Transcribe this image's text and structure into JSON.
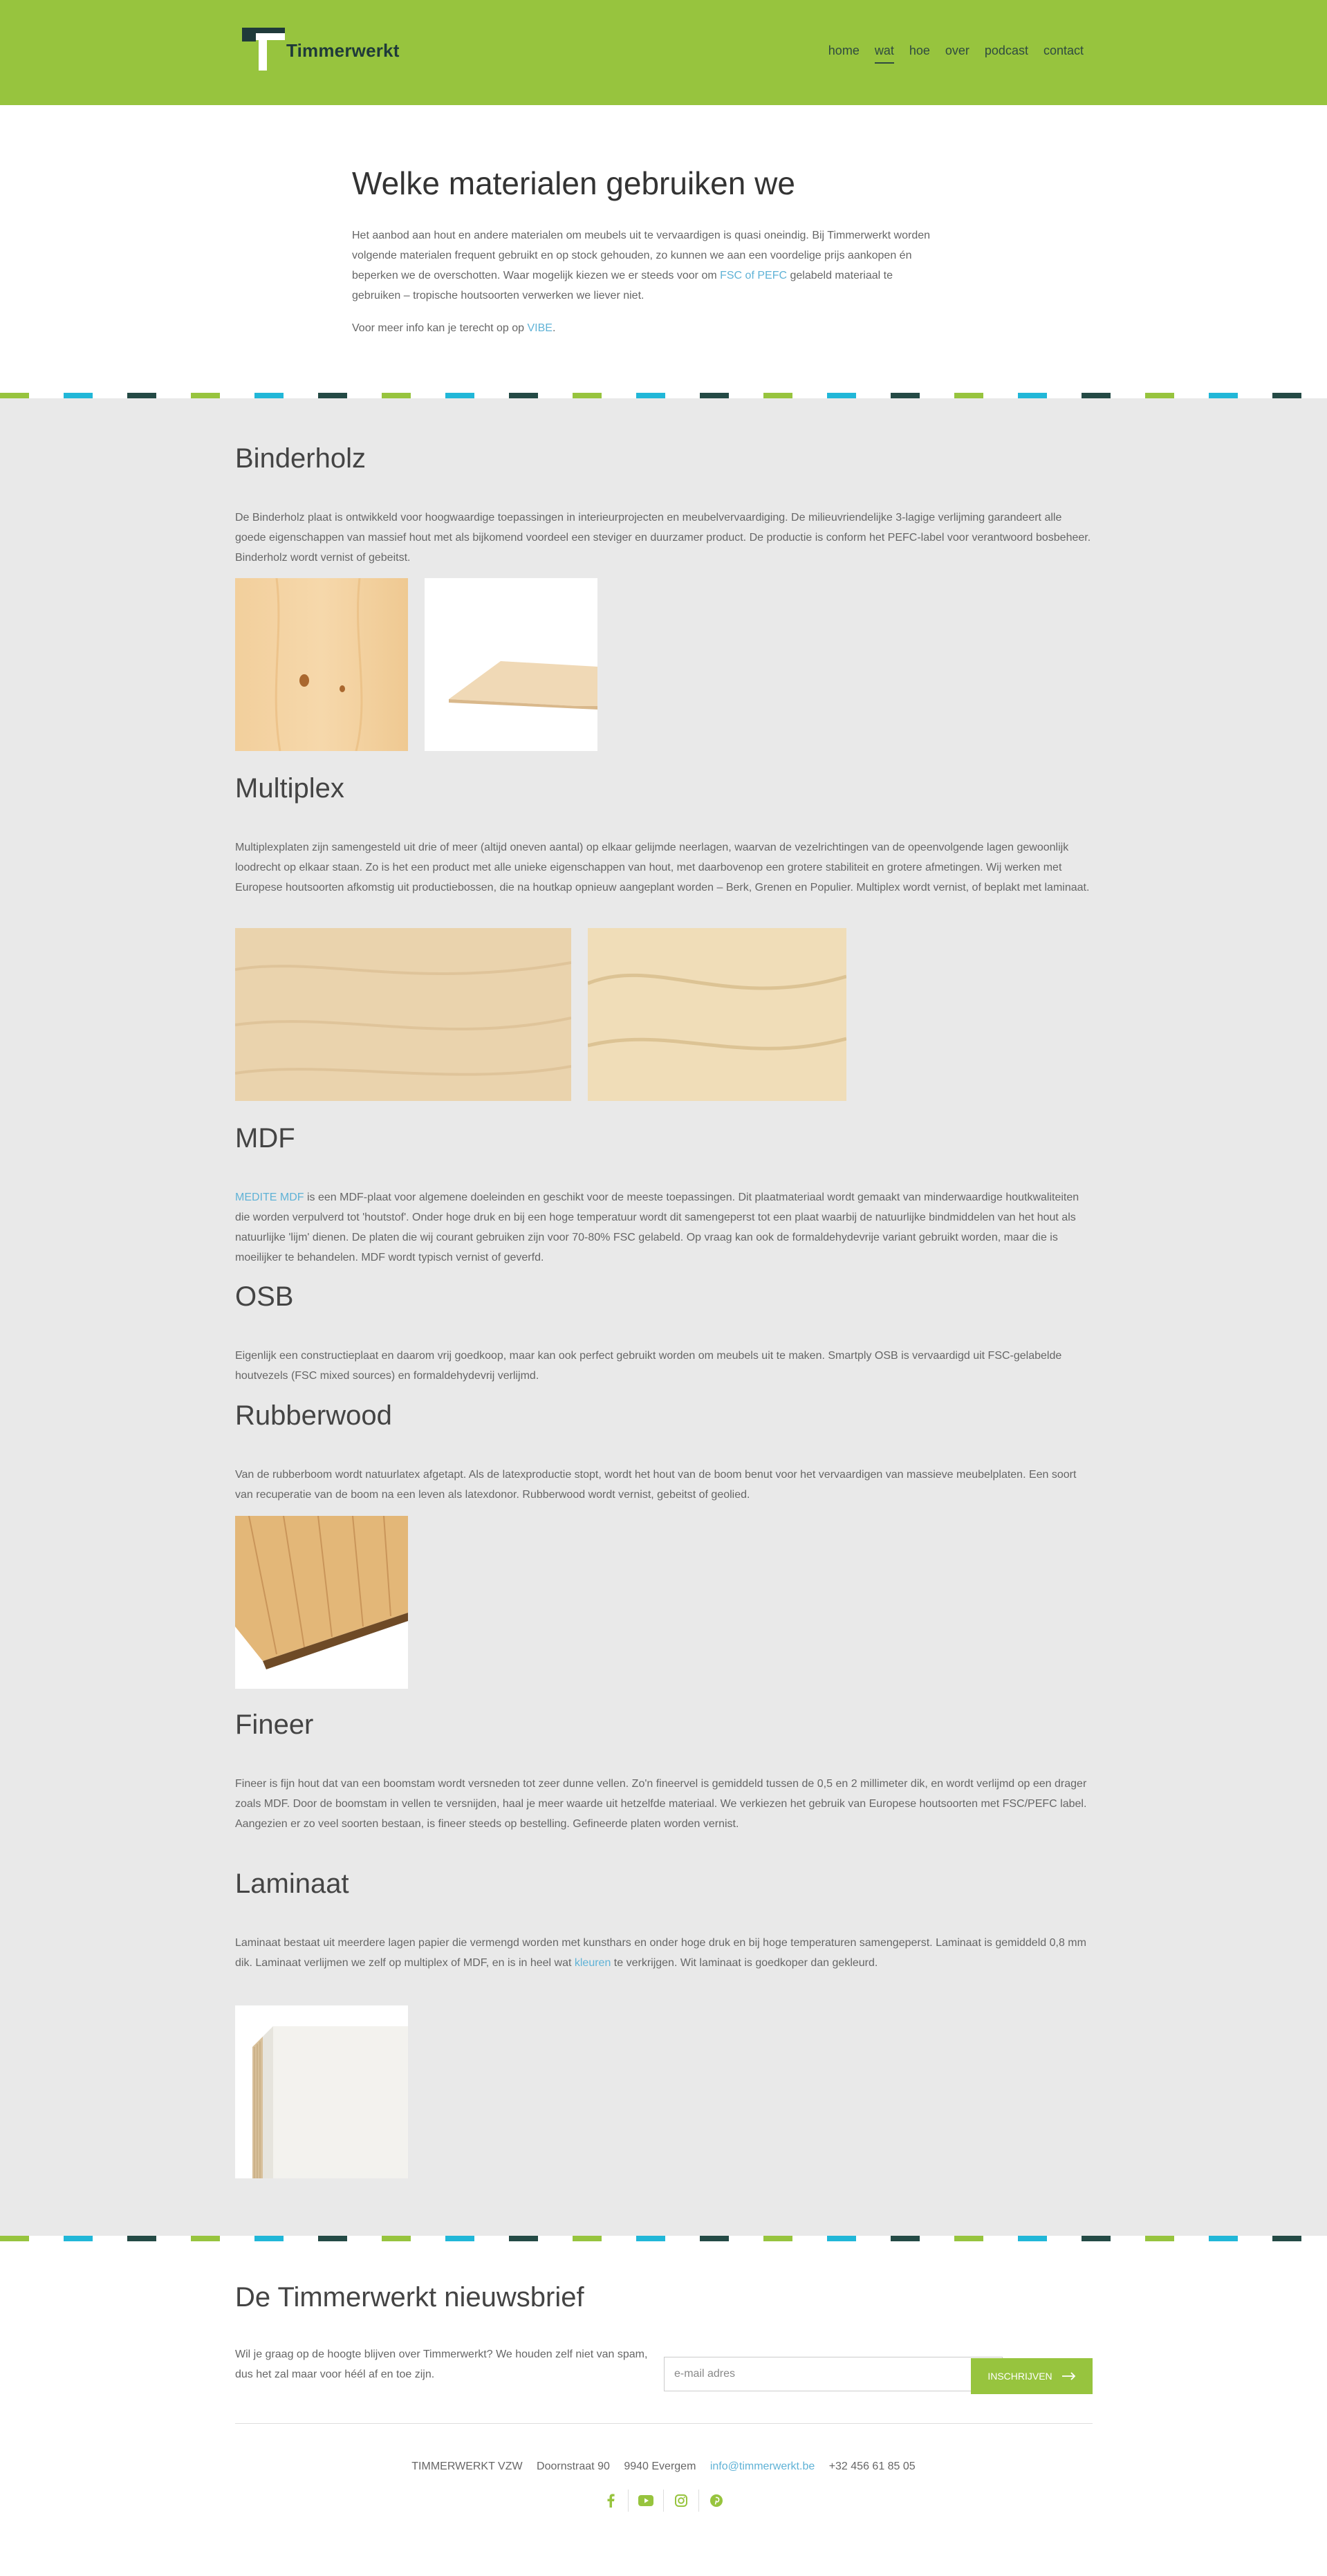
{
  "header": {
    "brand": "Timmerwerkt",
    "nav": [
      {
        "label": "home"
      },
      {
        "label": "wat"
      },
      {
        "label": "hoe"
      },
      {
        "label": "over"
      },
      {
        "label": "podcast"
      },
      {
        "label": "contact"
      }
    ]
  },
  "intro": {
    "title": "Welke materialen gebruiken we",
    "p1_a": "Het aanbod aan hout en andere materialen om meubels uit te vervaardigen is quasi oneindig. Bij Timmerwerkt worden volgende materialen frequent gebruikt en op stock gehouden, zo kunnen we aan een voordelige prijs aankopen én beperken we de overschotten. Waar mogelijk kiezen we er steeds voor om ",
    "p1_link": "FSC of PEFC",
    "p1_b": " gelabeld materiaal te gebruiken – tropische houtsoorten verwerken we liever niet.",
    "p2_a": "Voor meer info kan je terecht op op ",
    "p2_link": "VIBE",
    "p2_b": "."
  },
  "materials": {
    "binderholz": {
      "title": "Binderholz",
      "text": "De Binderholz plaat is ontwikkeld voor hoogwaardige toepassingen in interieurprojecten en meubelvervaardiging. De milieuvriendelijke 3-lagige verlijming garandeert alle goede eigenschappen van massief hout met als bijkomend voordeel een steviger en duurzamer product. De productie is conform het PEFC-label voor verantwoord bosbeheer. Binderholz wordt vernist of gebeitst."
    },
    "multiplex": {
      "title": "Multiplex",
      "text": "Multiplexplaten zijn samengesteld uit drie of meer (altijd oneven aantal) op elkaar gelijmde neerlagen, waarvan de vezelrichtingen van de opeenvolgende lagen gewoonlijk loodrecht op elkaar staan. Zo is het een product met alle unieke eigenschappen van hout, met daarbovenop een grotere stabiliteit en grotere afmetingen. Wij werken met Europese houtsoorten afkomstig uit productiebossen, die na houtkap opnieuw aangeplant worden – Berk, Grenen en Populier. Multiplex wordt vernist, of beplakt met laminaat."
    },
    "mdf": {
      "title": "MDF",
      "link": "MEDITE MDF",
      "text": " is een MDF-plaat voor algemene doeleinden en geschikt voor de meeste toepassingen. Dit plaatmateriaal wordt gemaakt van minderwaardige houtkwaliteiten die worden verpulverd tot 'houtstof'. Onder hoge druk en bij een hoge temperatuur wordt dit samengeperst tot een plaat waarbij de natuurlijke bindmiddelen van het hout als natuurlijke 'lijm' dienen. De platen die wij courant gebruiken zijn voor 70-80% FSC gelabeld. Op vraag kan ook de formaldehydevrije variant gebruikt worden, maar die is moeilijker te behandelen. MDF wordt typisch vernist of geverfd."
    },
    "osb": {
      "title": "OSB",
      "text": "Eigenlijk een constructieplaat en daarom vrij goedkoop, maar kan ook perfect gebruikt worden om meubels uit te maken. Smartply OSB is vervaardigd uit FSC-gelabelde houtvezels (FSC mixed sources) en formaldehydevrij verlijmd."
    },
    "rubberwood": {
      "title": "Rubberwood",
      "text": "Van de rubberboom wordt natuurlatex afgetapt. Als de latexproductie stopt, wordt het hout van de boom benut voor het vervaardigen van massieve meubelplaten. Een soort van recuperatie van de boom na een leven als latexdonor. Rubberwood wordt vernist, gebeitst of geolied."
    },
    "fineer": {
      "title": "Fineer",
      "text": "Fineer is fijn hout dat van een boomstam wordt versneden tot zeer dunne vellen. Zo'n fineervel is gemiddeld tussen de 0,5 en 2 millimeter dik, en wordt verlijmd op een drager zoals MDF. Door de boomstam in vellen te versnijden, haal je meer waarde uit hetzelfde materiaal. We verkiezen het gebruik van Europese houtsoorten met FSC/PEFC label. Aangezien er zo veel soorten bestaan, is fineer steeds op bestelling. Gefineerde platen worden vernist."
    },
    "laminaat": {
      "title": "Laminaat",
      "text_a": "Laminaat bestaat uit meerdere lagen papier die vermengd worden met kunsthars en onder hoge druk en bij hoge temperaturen samengeperst. Laminaat is gemiddeld 0,8 mm dik. Laminaat verlijmen we zelf op multiplex of MDF, en is in heel wat ",
      "link": "kleuren",
      "text_b": " te verkrijgen. Wit laminaat is goedkoper dan gekleurd."
    }
  },
  "newsletter": {
    "title": "De Timmerwerkt nieuwsbrief",
    "text": "Wil je graag op de hoogte blijven over Timmerwerkt? We houden zelf niet van spam, dus het zal maar voor héél af en toe zijn.",
    "placeholder": "e-mail adres",
    "button": "INSCHRIJVEN"
  },
  "footer": {
    "org": "TIMMERWERKT VZW",
    "street": "Doornstraat 90",
    "city": "9940 Evergem",
    "email": "info@timmerwerkt.be",
    "phone": "+32 456 61 85 05",
    "social": [
      "facebook-icon",
      "youtube-icon",
      "instagram-icon",
      "pinterest-icon"
    ]
  },
  "colors": {
    "brand_green": "#97c43e",
    "stripe_blue": "#21b7d8",
    "stripe_dark": "#244a45",
    "link_blue": "#5fb2d6"
  }
}
